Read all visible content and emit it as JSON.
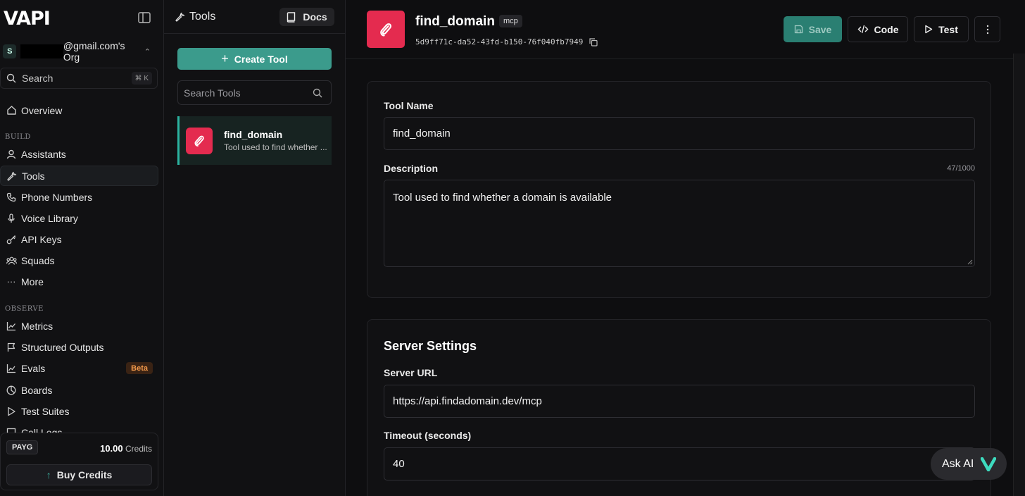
{
  "app": {
    "logo": "VAPI"
  },
  "sidebar": {
    "org_avatar": "S",
    "org_name": "@gmail.com's Org",
    "search_label": "Search",
    "search_shortcut": "⌘ K",
    "overview": "Overview",
    "build_section": "BUILD",
    "build_items": [
      {
        "label": "Assistants",
        "icon": "user-icon"
      },
      {
        "label": "Tools",
        "icon": "wrench-icon",
        "active": true
      },
      {
        "label": "Phone Numbers",
        "icon": "phone-icon"
      },
      {
        "label": "Voice Library",
        "icon": "mic-icon"
      },
      {
        "label": "API Keys",
        "icon": "key-icon"
      },
      {
        "label": "Squads",
        "icon": "users-icon"
      },
      {
        "label": "More",
        "icon": "ellipsis-icon"
      }
    ],
    "observe_section": "OBSERVE",
    "observe_items": [
      {
        "label": "Metrics",
        "icon": "chart-line-icon"
      },
      {
        "label": "Structured Outputs",
        "icon": "flag-icon"
      },
      {
        "label": "Evals",
        "icon": "chart-icon",
        "badge": "Beta"
      },
      {
        "label": "Boards",
        "icon": "pie-icon"
      },
      {
        "label": "Test Suites",
        "icon": "play-icon"
      },
      {
        "label": "Call Logs",
        "icon": "list-icon"
      }
    ],
    "plan": "PAYG",
    "credits_value": "10.00",
    "credits_label": "Credits",
    "buy_credits": "Buy Credits"
  },
  "tools": {
    "title": "Tools",
    "docs": "Docs",
    "create": "Create Tool",
    "search_placeholder": "Search Tools",
    "list": [
      {
        "name": "find_domain",
        "desc": "Tool used to find whether ..."
      }
    ]
  },
  "main": {
    "tool_name": "find_domain",
    "badge": "mcp",
    "tool_id": "5d9ff71c-da52-43fd-b150-76f040fb7949",
    "save": "Save",
    "code": "Code",
    "test": "Test",
    "tool_name_label": "Tool Name",
    "tool_name_value": "find_domain",
    "description_label": "Description",
    "description_count": "47/1000",
    "description_value": "Tool used to find whether a domain is available",
    "server_title": "Server Settings",
    "server_url_label": "Server URL",
    "server_url_value": "https://api.findadomain.dev/mcp",
    "timeout_label": "Timeout (seconds)",
    "timeout_value": "40"
  },
  "ask_ai": "Ask AI",
  "colors": {
    "accent": "#3b9b8c",
    "tool_icon": "#e42b4f",
    "beta": "#f2994a"
  }
}
